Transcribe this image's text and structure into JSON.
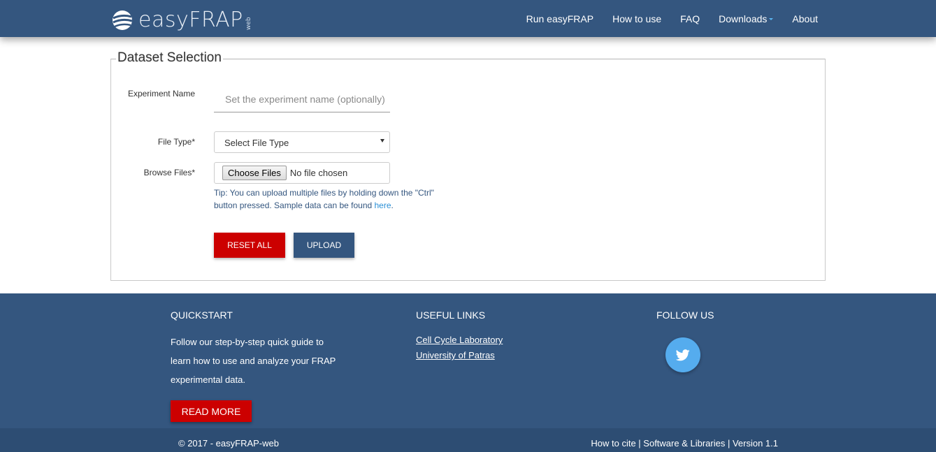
{
  "navbar": {
    "brand": "easyFRAP",
    "brand_sub": "web",
    "items": [
      {
        "label": "Run easyFRAP"
      },
      {
        "label": "How to use"
      },
      {
        "label": "FAQ"
      },
      {
        "label": "Downloads"
      },
      {
        "label": "About"
      }
    ]
  },
  "form": {
    "legend": "Dataset Selection",
    "experiment_label": "Experiment Name",
    "experiment_placeholder": "Set the experiment name (optionally)",
    "filetype_label": "File Type*",
    "filetype_value": "Select File Type",
    "browse_label": "Browse Files*",
    "choose_button": "Choose Files",
    "file_status": "No file chosen",
    "tip_text": "Tip: You can upload multiple files by holding down the \"Ctrl\" button pressed. Sample data can be found ",
    "tip_link": "here",
    "tip_end": ".",
    "reset_button": "RESET ALL",
    "upload_button": "UPLOAD"
  },
  "footer": {
    "quickstart_title": "QUICKSTART",
    "quickstart_text": "Follow our step-by-step quick guide to learn how to use and analyze your FRAP experimental data.",
    "read_more": "READ MORE",
    "links_title": "USEFUL LINKS",
    "links": [
      "Cell Cycle Laboratory",
      "University of Patras"
    ],
    "follow_title": "FOLLOW US",
    "copyright": "© 2017 - easyFRAP-web",
    "right_links": "How to cite | Software & Libraries | Version 1.1"
  },
  "colors": {
    "primary": "#34567f",
    "danger": "#cc0000",
    "twitter": "#55acee"
  }
}
